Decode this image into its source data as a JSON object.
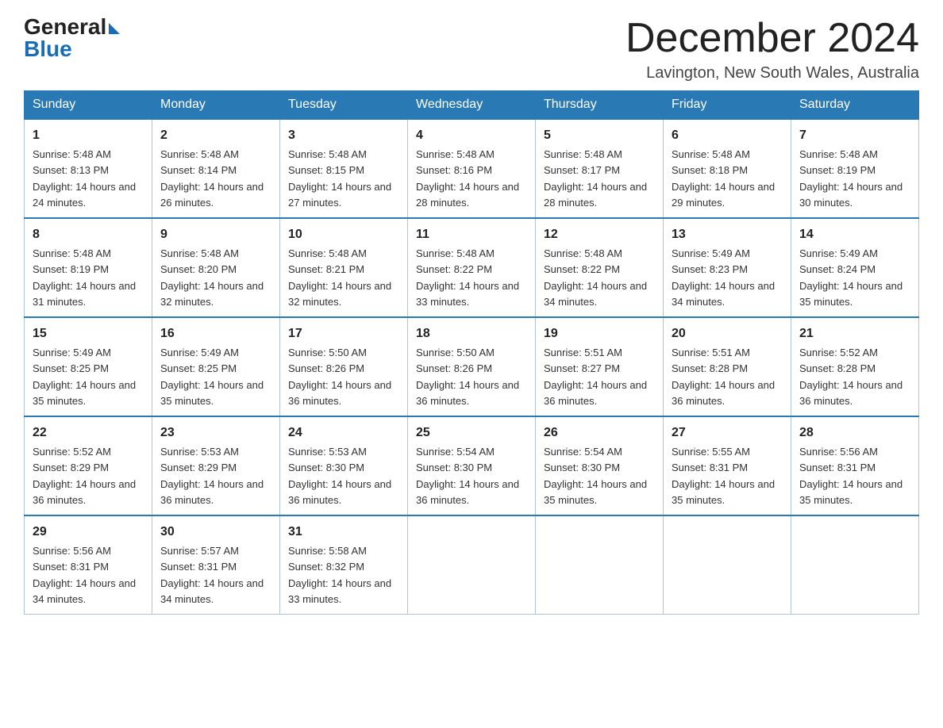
{
  "header": {
    "logo_general": "General",
    "logo_blue": "Blue",
    "month_year": "December 2024",
    "location": "Lavington, New South Wales, Australia"
  },
  "days_of_week": [
    "Sunday",
    "Monday",
    "Tuesday",
    "Wednesday",
    "Thursday",
    "Friday",
    "Saturday"
  ],
  "weeks": [
    [
      {
        "day": "1",
        "sunrise": "5:48 AM",
        "sunset": "8:13 PM",
        "daylight": "14 hours and 24 minutes."
      },
      {
        "day": "2",
        "sunrise": "5:48 AM",
        "sunset": "8:14 PM",
        "daylight": "14 hours and 26 minutes."
      },
      {
        "day": "3",
        "sunrise": "5:48 AM",
        "sunset": "8:15 PM",
        "daylight": "14 hours and 27 minutes."
      },
      {
        "day": "4",
        "sunrise": "5:48 AM",
        "sunset": "8:16 PM",
        "daylight": "14 hours and 28 minutes."
      },
      {
        "day": "5",
        "sunrise": "5:48 AM",
        "sunset": "8:17 PM",
        "daylight": "14 hours and 28 minutes."
      },
      {
        "day": "6",
        "sunrise": "5:48 AM",
        "sunset": "8:18 PM",
        "daylight": "14 hours and 29 minutes."
      },
      {
        "day": "7",
        "sunrise": "5:48 AM",
        "sunset": "8:19 PM",
        "daylight": "14 hours and 30 minutes."
      }
    ],
    [
      {
        "day": "8",
        "sunrise": "5:48 AM",
        "sunset": "8:19 PM",
        "daylight": "14 hours and 31 minutes."
      },
      {
        "day": "9",
        "sunrise": "5:48 AM",
        "sunset": "8:20 PM",
        "daylight": "14 hours and 32 minutes."
      },
      {
        "day": "10",
        "sunrise": "5:48 AM",
        "sunset": "8:21 PM",
        "daylight": "14 hours and 32 minutes."
      },
      {
        "day": "11",
        "sunrise": "5:48 AM",
        "sunset": "8:22 PM",
        "daylight": "14 hours and 33 minutes."
      },
      {
        "day": "12",
        "sunrise": "5:48 AM",
        "sunset": "8:22 PM",
        "daylight": "14 hours and 34 minutes."
      },
      {
        "day": "13",
        "sunrise": "5:49 AM",
        "sunset": "8:23 PM",
        "daylight": "14 hours and 34 minutes."
      },
      {
        "day": "14",
        "sunrise": "5:49 AM",
        "sunset": "8:24 PM",
        "daylight": "14 hours and 35 minutes."
      }
    ],
    [
      {
        "day": "15",
        "sunrise": "5:49 AM",
        "sunset": "8:25 PM",
        "daylight": "14 hours and 35 minutes."
      },
      {
        "day": "16",
        "sunrise": "5:49 AM",
        "sunset": "8:25 PM",
        "daylight": "14 hours and 35 minutes."
      },
      {
        "day": "17",
        "sunrise": "5:50 AM",
        "sunset": "8:26 PM",
        "daylight": "14 hours and 36 minutes."
      },
      {
        "day": "18",
        "sunrise": "5:50 AM",
        "sunset": "8:26 PM",
        "daylight": "14 hours and 36 minutes."
      },
      {
        "day": "19",
        "sunrise": "5:51 AM",
        "sunset": "8:27 PM",
        "daylight": "14 hours and 36 minutes."
      },
      {
        "day": "20",
        "sunrise": "5:51 AM",
        "sunset": "8:28 PM",
        "daylight": "14 hours and 36 minutes."
      },
      {
        "day": "21",
        "sunrise": "5:52 AM",
        "sunset": "8:28 PM",
        "daylight": "14 hours and 36 minutes."
      }
    ],
    [
      {
        "day": "22",
        "sunrise": "5:52 AM",
        "sunset": "8:29 PM",
        "daylight": "14 hours and 36 minutes."
      },
      {
        "day": "23",
        "sunrise": "5:53 AM",
        "sunset": "8:29 PM",
        "daylight": "14 hours and 36 minutes."
      },
      {
        "day": "24",
        "sunrise": "5:53 AM",
        "sunset": "8:30 PM",
        "daylight": "14 hours and 36 minutes."
      },
      {
        "day": "25",
        "sunrise": "5:54 AM",
        "sunset": "8:30 PM",
        "daylight": "14 hours and 36 minutes."
      },
      {
        "day": "26",
        "sunrise": "5:54 AM",
        "sunset": "8:30 PM",
        "daylight": "14 hours and 35 minutes."
      },
      {
        "day": "27",
        "sunrise": "5:55 AM",
        "sunset": "8:31 PM",
        "daylight": "14 hours and 35 minutes."
      },
      {
        "day": "28",
        "sunrise": "5:56 AM",
        "sunset": "8:31 PM",
        "daylight": "14 hours and 35 minutes."
      }
    ],
    [
      {
        "day": "29",
        "sunrise": "5:56 AM",
        "sunset": "8:31 PM",
        "daylight": "14 hours and 34 minutes."
      },
      {
        "day": "30",
        "sunrise": "5:57 AM",
        "sunset": "8:31 PM",
        "daylight": "14 hours and 34 minutes."
      },
      {
        "day": "31",
        "sunrise": "5:58 AM",
        "sunset": "8:32 PM",
        "daylight": "14 hours and 33 minutes."
      },
      null,
      null,
      null,
      null
    ]
  ]
}
